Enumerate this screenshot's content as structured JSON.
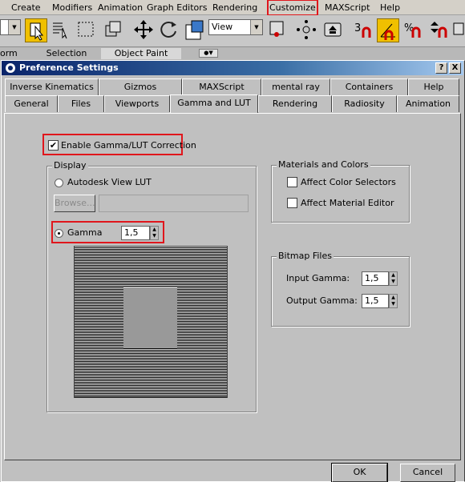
{
  "menu": {
    "items": [
      "Create",
      "Modifiers",
      "Animation",
      "Graph Editors",
      "Rendering",
      "Customize",
      "MAXScript",
      "Help"
    ]
  },
  "toolbar": {
    "view_combo": "View",
    "icons": [
      "select-object-icon",
      "select-by-name-icon",
      "rectangle-region-icon",
      "window-crossing-icon",
      "move-icon",
      "rotate-icon",
      "scale-icon",
      "reference-coord-icon",
      "pivot-icon",
      "mirror-icon",
      "align-icon",
      "snaps-3d-icon",
      "angle-snap-icon",
      "percent-snap-icon",
      "spinner-snap-icon",
      "layer-icon"
    ]
  },
  "ribbon": {
    "tab_left": "orm",
    "tab_selection": "Selection",
    "tab_object_paint": "Object Paint"
  },
  "dialog": {
    "title": "Preference Settings",
    "help_btn": "?",
    "close_btn": "X",
    "tabs_row1": [
      "Inverse Kinematics",
      "Gizmos",
      "MAXScript",
      "mental ray",
      "Containers",
      "Help"
    ],
    "tabs_row2": [
      "General",
      "Files",
      "Viewports",
      "Gamma and LUT",
      "Rendering",
      "Radiosity",
      "Animation"
    ],
    "active_tab": "Gamma and LUT"
  },
  "gamma": {
    "enable_label": "Enable Gamma/LUT Correction",
    "enable_checked": true,
    "display_group": "Display",
    "lut_label": "Autodesk View LUT",
    "browse_label": "Browse...",
    "gamma_label": "Gamma",
    "gamma_value": "1,5",
    "materials_group": "Materials and Colors",
    "affect_color": "Affect Color Selectors",
    "affect_material": "Affect Material Editor",
    "bitmap_group": "Bitmap Files",
    "input_gamma_label": "Input Gamma:",
    "input_gamma_value": "1,5",
    "output_gamma_label": "Output Gamma:",
    "output_gamma_value": "1,5"
  },
  "buttons": {
    "ok": "OK",
    "cancel": "Cancel"
  },
  "colors": {
    "highlight": "#e0161c",
    "title_bar": "#0a246a",
    "active_tool": "#f0c000"
  }
}
